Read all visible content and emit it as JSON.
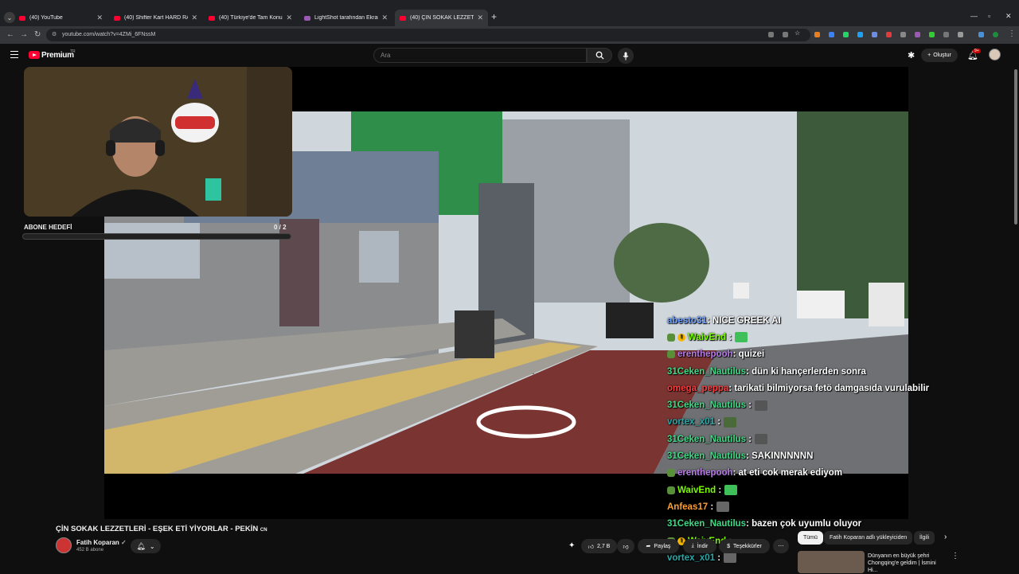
{
  "browser": {
    "tabs": [
      {
        "title": "(40) YouTube",
        "icon": "youtube-favicon",
        "active": false
      },
      {
        "title": "(40) Shifter Kart HARD RACING",
        "icon": "youtube-favicon",
        "active": false
      },
      {
        "title": "(40) Türkiye'de Tam Konumu B...",
        "icon": "youtube-favicon",
        "active": false
      },
      {
        "title": "LightShot tarafından Ekran Gör...",
        "icon": "lightshot-favicon",
        "active": false
      },
      {
        "title": "(40) ÇİN SOKAK LEZZETLERİ - E...",
        "icon": "youtube-favicon",
        "active": true
      }
    ],
    "url": "youtube.com/watch?v=4ZMi_6FNssM"
  },
  "youtube": {
    "brand": "Premium",
    "region": "TR",
    "search_placeholder": "Ara",
    "create_label": "Oluştur",
    "notification_count": "9+"
  },
  "stream_overlay": {
    "sub_goal_label": "ABONE HEDEFİ",
    "sub_goal_count": "0  / 2",
    "sub_goal_progress": 0
  },
  "chat": [
    {
      "user": "abesto31",
      "message": ": NICE GREEK AI",
      "color": "#6fa0ff",
      "badges": [],
      "emote": null
    },
    {
      "user": "WaivEnd",
      "message": " :",
      "color": "#7cfc00",
      "badges": [
        "sub-badge",
        "gift-badge"
      ],
      "emote": "#3fbf5a"
    },
    {
      "user": "erenthepooh",
      "message": ": quizei",
      "color": "#b77ce8",
      "badges": [
        "sub-badge"
      ],
      "emote": null
    },
    {
      "user": "31Ceken_Nautilus",
      "message": ": dün ki hançerlerden sonra",
      "color": "#3ddc84",
      "badges": [],
      "emote": null
    },
    {
      "user": "omega_peppa",
      "message": ": tarikati bilmiyorsa fetö damgasıda vurulabilir",
      "color": "#ff3b3b",
      "badges": [],
      "emote": null
    },
    {
      "user": "31Ceken_Nautilus",
      "message": " :",
      "color": "#3ddc84",
      "badges": [],
      "emote": "#555555"
    },
    {
      "user": "vortex_x01",
      "message": " :",
      "color": "#2aa8a8",
      "badges": [],
      "emote": "#4a6a3a"
    },
    {
      "user": "31Ceken_Nautilus",
      "message": " :",
      "color": "#3ddc84",
      "badges": [],
      "emote": "#555555"
    },
    {
      "user": "31Ceken_Nautilus",
      "message": ": SAKINNNNNN",
      "color": "#3ddc84",
      "badges": [],
      "emote": null
    },
    {
      "user": "erenthepooh",
      "message": ": at eti cok merak ediyom",
      "color": "#b77ce8",
      "badges": [
        "sub-badge"
      ],
      "emote": null
    },
    {
      "user": "WaivEnd",
      "message": " :",
      "color": "#7cfc00",
      "badges": [
        "sub-badge"
      ],
      "emote": "#3fbf5a"
    },
    {
      "user": "Anfeas17",
      "message": " :",
      "color": "#ff9d2e",
      "badges": [],
      "emote": "#666666"
    },
    {
      "user": "31Ceken_Nautilus",
      "message": ": bazen çok uyumlu oluyor",
      "color": "#3ddc84",
      "badges": [],
      "emote": null
    },
    {
      "user": "WaivEnd",
      "message": " :",
      "color": "#7cfc00",
      "badges": [
        "sub-badge",
        "gift-badge"
      ],
      "emote": null
    },
    {
      "user": "vortex_x01",
      "message": " :",
      "color": "#2aa8a8",
      "badges": [],
      "emote": "#666666"
    }
  ],
  "video": {
    "title": "ÇİN SOKAK LEZZETLERİ - EŞEK ETİ YİYORLAR - PEKİN",
    "flag": "CN",
    "channel": "Fatih Koparan",
    "subscribers": "452 B abone",
    "likes": "2,7 B",
    "share_label": "Paylaş",
    "download_label": "İndir",
    "thanks_label": "Teşekkürler"
  },
  "recommendations": {
    "chips": [
      "Tümü",
      "Fatih Koparan adlı yükleyiciden",
      "İlgili"
    ],
    "first_title": "Dünyanın en büyük şehri Chongqing'e geldim | İsmini Hi..."
  }
}
